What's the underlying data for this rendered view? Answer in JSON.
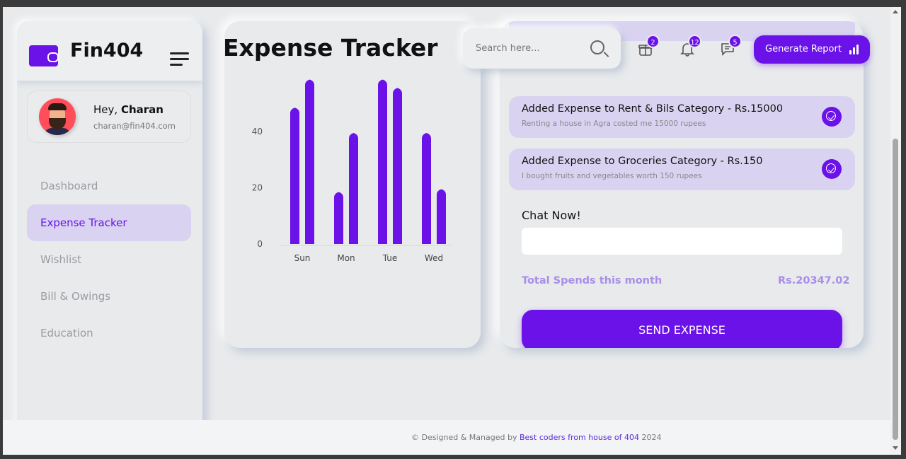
{
  "app": {
    "brand": "Fin404"
  },
  "user": {
    "greeting": "Hey,",
    "name": "Charan",
    "email": "charan@fin404.com"
  },
  "sidebar": {
    "items": [
      {
        "label": "Dashboard",
        "active": false
      },
      {
        "label": "Expense Tracker",
        "active": true
      },
      {
        "label": "Wishlist",
        "active": false
      },
      {
        "label": "Bill & Owings",
        "active": false
      },
      {
        "label": "Education",
        "active": false
      }
    ]
  },
  "header": {
    "title": "Expense Tracker",
    "search_placeholder": "Search here...",
    "gift_count": "2",
    "notification_count": "12",
    "message_count": "5",
    "report_button": "Generate Report"
  },
  "chart_data": {
    "type": "bar",
    "categories": [
      "Sun",
      "Mon",
      "Tue",
      "Wed"
    ],
    "series": [
      {
        "values": [
          48,
          18,
          58,
          39
        ]
      },
      {
        "values": [
          58,
          39,
          55,
          19
        ]
      }
    ],
    "yticks": [
      "0",
      "20",
      "40"
    ],
    "ylim": [
      0,
      58
    ],
    "color": "#6a12e8"
  },
  "expenses": [
    {
      "title": "Added Expense to Rent & Bils Category - Rs.15000",
      "description": "Renting a house in Agra costed me 15000 rupees"
    },
    {
      "title": "Added Expense to Groceries Category - Rs.150",
      "description": "I bought fruits and vegetables worth 150 rupees"
    }
  ],
  "chat": {
    "label": "Chat Now!",
    "value": ""
  },
  "totals": {
    "label": "Total Spends this month",
    "value": "Rs.20347.02"
  },
  "send_button": "SEND EXPENSE",
  "footer": {
    "prefix": "© Designed & Managed by",
    "link": "Best coders from house of 404",
    "year": "2024"
  },
  "colors": {
    "accent": "#6a12e8",
    "accent_light": "#d9d3f1",
    "background": "#e8eaec"
  }
}
